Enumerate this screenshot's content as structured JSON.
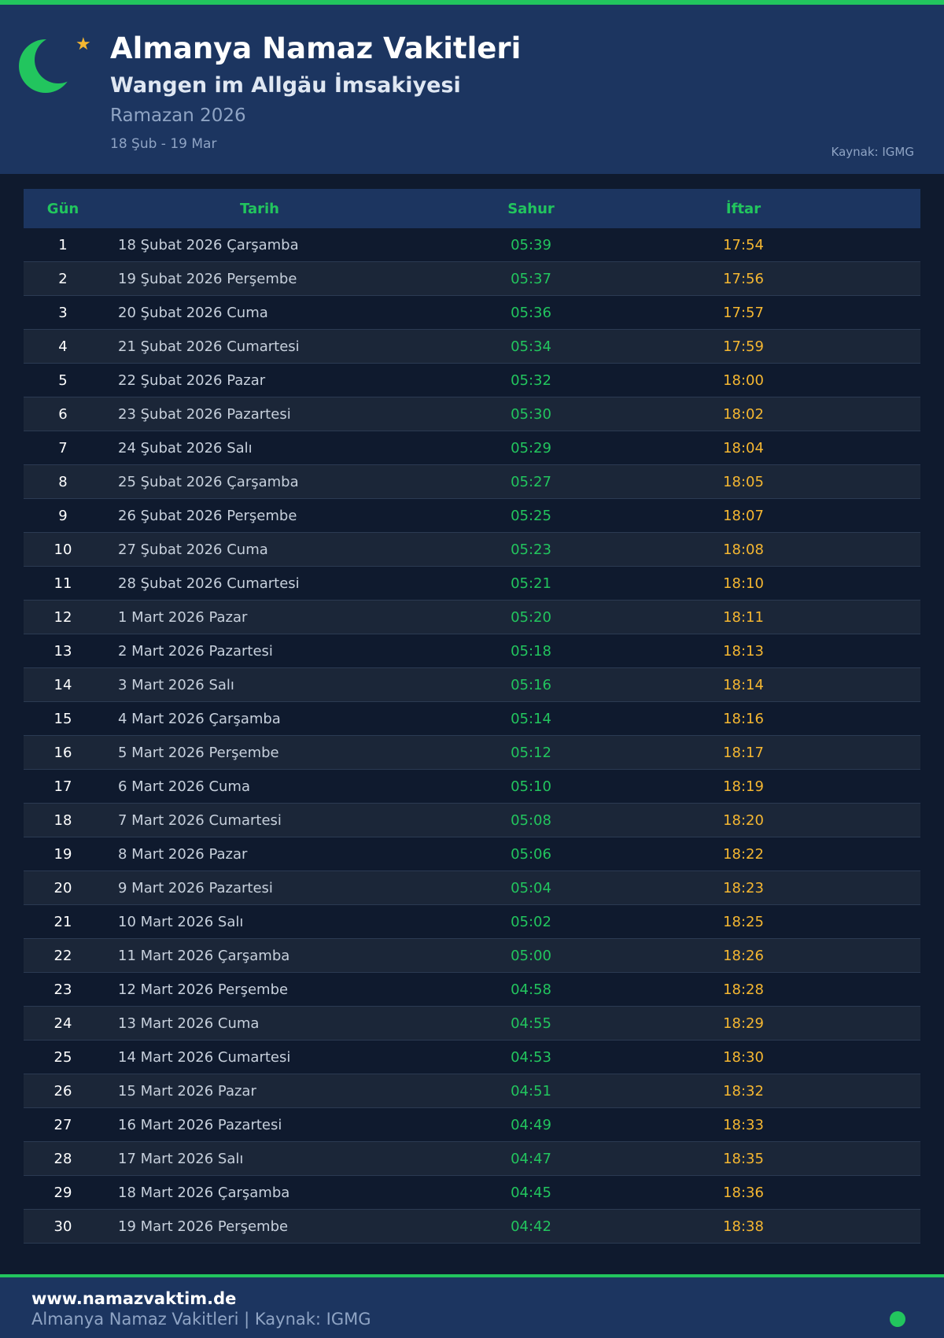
{
  "header": {
    "title": "Almanya Namaz Vakitleri",
    "subtitle": "Wangen im Allgäu İmsakiyesi",
    "ramadan": "Ramazan 2026",
    "date_range": "18 Şub - 19 Mar",
    "source": "Kaynak: IGMG"
  },
  "colors": {
    "accent_green": "#22c55e",
    "iftar_gold": "#f5b731",
    "header_bg": "#1c3560",
    "page_bg": "#0f1a2e"
  },
  "icons": {
    "logo": "crescent-moon-icon",
    "star": "star-icon",
    "status": "status-dot"
  },
  "table": {
    "headers": {
      "day": "Gün",
      "date": "Tarih",
      "sahur": "Sahur",
      "iftar": "İftar"
    },
    "rows": [
      {
        "day": "1",
        "date": "18 Şubat 2026 Çarşamba",
        "sahur": "05:39",
        "iftar": "17:54"
      },
      {
        "day": "2",
        "date": "19 Şubat 2026 Perşembe",
        "sahur": "05:37",
        "iftar": "17:56"
      },
      {
        "day": "3",
        "date": "20 Şubat 2026 Cuma",
        "sahur": "05:36",
        "iftar": "17:57"
      },
      {
        "day": "4",
        "date": "21 Şubat 2026 Cumartesi",
        "sahur": "05:34",
        "iftar": "17:59"
      },
      {
        "day": "5",
        "date": "22 Şubat 2026 Pazar",
        "sahur": "05:32",
        "iftar": "18:00"
      },
      {
        "day": "6",
        "date": "23 Şubat 2026 Pazartesi",
        "sahur": "05:30",
        "iftar": "18:02"
      },
      {
        "day": "7",
        "date": "24 Şubat 2026 Salı",
        "sahur": "05:29",
        "iftar": "18:04"
      },
      {
        "day": "8",
        "date": "25 Şubat 2026 Çarşamba",
        "sahur": "05:27",
        "iftar": "18:05"
      },
      {
        "day": "9",
        "date": "26 Şubat 2026 Perşembe",
        "sahur": "05:25",
        "iftar": "18:07"
      },
      {
        "day": "10",
        "date": "27 Şubat 2026 Cuma",
        "sahur": "05:23",
        "iftar": "18:08"
      },
      {
        "day": "11",
        "date": "28 Şubat 2026 Cumartesi",
        "sahur": "05:21",
        "iftar": "18:10"
      },
      {
        "day": "12",
        "date": "1 Mart 2026 Pazar",
        "sahur": "05:20",
        "iftar": "18:11"
      },
      {
        "day": "13",
        "date": "2 Mart 2026 Pazartesi",
        "sahur": "05:18",
        "iftar": "18:13"
      },
      {
        "day": "14",
        "date": "3 Mart 2026 Salı",
        "sahur": "05:16",
        "iftar": "18:14"
      },
      {
        "day": "15",
        "date": "4 Mart 2026 Çarşamba",
        "sahur": "05:14",
        "iftar": "18:16"
      },
      {
        "day": "16",
        "date": "5 Mart 2026 Perşembe",
        "sahur": "05:12",
        "iftar": "18:17"
      },
      {
        "day": "17",
        "date": "6 Mart 2026 Cuma",
        "sahur": "05:10",
        "iftar": "18:19"
      },
      {
        "day": "18",
        "date": "7 Mart 2026 Cumartesi",
        "sahur": "05:08",
        "iftar": "18:20"
      },
      {
        "day": "19",
        "date": "8 Mart 2026 Pazar",
        "sahur": "05:06",
        "iftar": "18:22"
      },
      {
        "day": "20",
        "date": "9 Mart 2026 Pazartesi",
        "sahur": "05:04",
        "iftar": "18:23"
      },
      {
        "day": "21",
        "date": "10 Mart 2026 Salı",
        "sahur": "05:02",
        "iftar": "18:25"
      },
      {
        "day": "22",
        "date": "11 Mart 2026 Çarşamba",
        "sahur": "05:00",
        "iftar": "18:26"
      },
      {
        "day": "23",
        "date": "12 Mart 2026 Perşembe",
        "sahur": "04:58",
        "iftar": "18:28"
      },
      {
        "day": "24",
        "date": "13 Mart 2026 Cuma",
        "sahur": "04:55",
        "iftar": "18:29"
      },
      {
        "day": "25",
        "date": "14 Mart 2026 Cumartesi",
        "sahur": "04:53",
        "iftar": "18:30"
      },
      {
        "day": "26",
        "date": "15 Mart 2026 Pazar",
        "sahur": "04:51",
        "iftar": "18:32"
      },
      {
        "day": "27",
        "date": "16 Mart 2026 Pazartesi",
        "sahur": "04:49",
        "iftar": "18:33"
      },
      {
        "day": "28",
        "date": "17 Mart 2026 Salı",
        "sahur": "04:47",
        "iftar": "18:35"
      },
      {
        "day": "29",
        "date": "18 Mart 2026 Çarşamba",
        "sahur": "04:45",
        "iftar": "18:36"
      },
      {
        "day": "30",
        "date": "19 Mart 2026 Perşembe",
        "sahur": "04:42",
        "iftar": "18:38"
      }
    ]
  },
  "footer": {
    "url": "www.namazvaktim.de",
    "text": "Almanya Namaz Vakitleri | Kaynak: IGMG"
  }
}
